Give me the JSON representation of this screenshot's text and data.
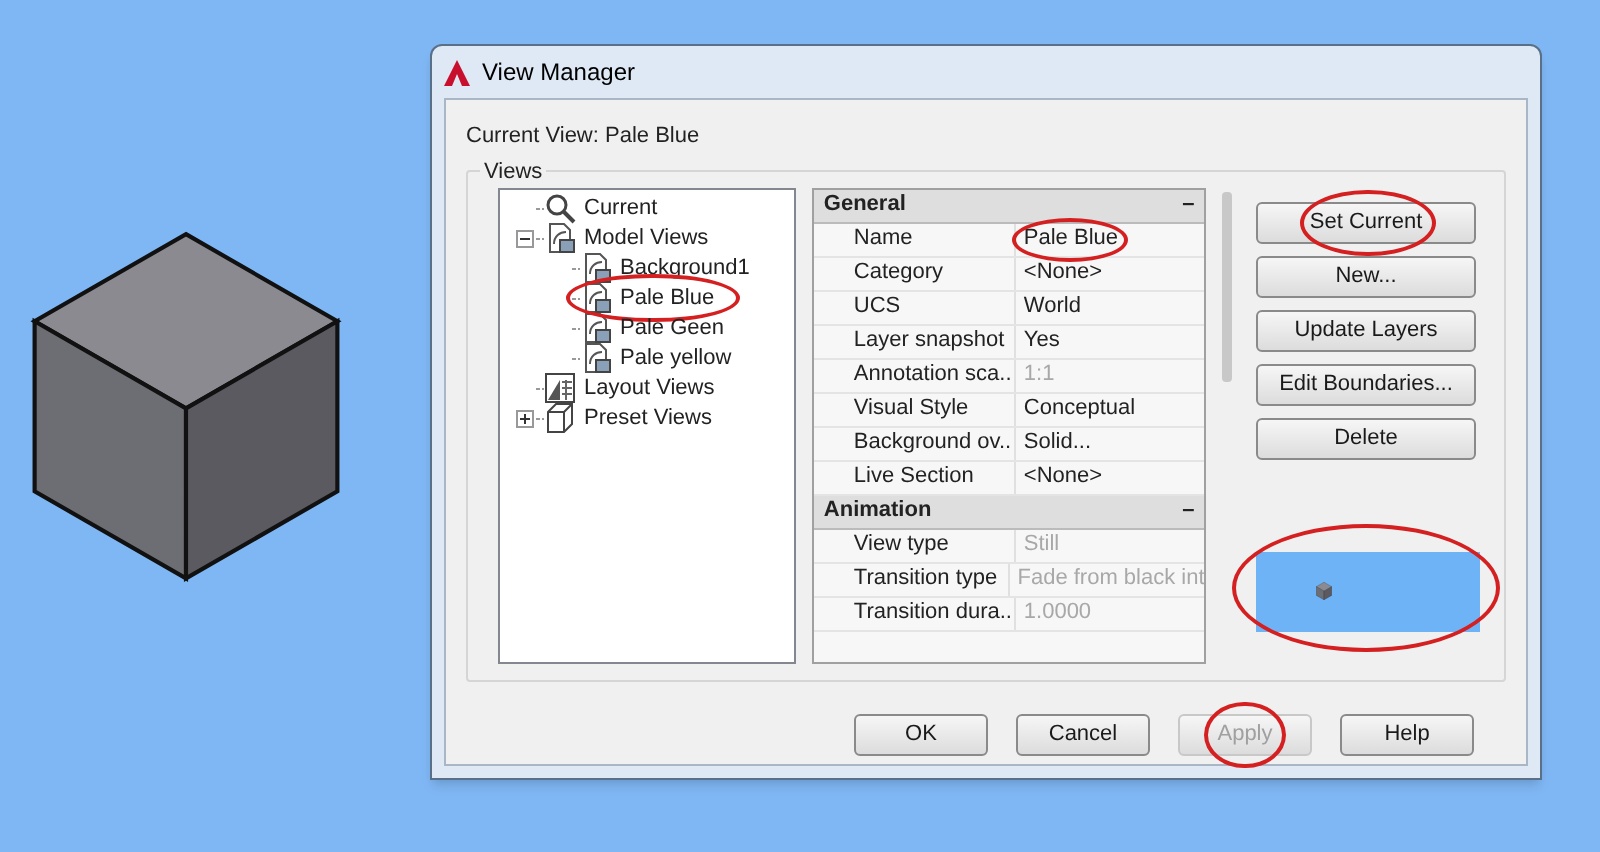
{
  "window": {
    "title": "View Manager"
  },
  "current_view": "Current View: Pale Blue",
  "views_group": {
    "label": "Views"
  },
  "tree": {
    "items": [
      {
        "label": "Current",
        "kind": "current",
        "selected": false,
        "circled": false
      },
      {
        "label": "Model Views",
        "kind": "model",
        "expanded": true,
        "selected": false,
        "circled": false,
        "children": [
          {
            "label": "Background1",
            "kind": "view",
            "selected": false,
            "circled": false
          },
          {
            "label": "Pale Blue",
            "kind": "view",
            "selected": false,
            "circled": true
          },
          {
            "label": "Pale Geen",
            "kind": "view",
            "selected": false,
            "circled": false
          },
          {
            "label": "Pale yellow",
            "kind": "view",
            "selected": false,
            "circled": false
          }
        ]
      },
      {
        "label": "Layout Views",
        "kind": "layout",
        "selected": false,
        "circled": false
      },
      {
        "label": "Preset Views",
        "kind": "preset",
        "expanded": false,
        "selected": false,
        "circled": false
      }
    ]
  },
  "properties": {
    "sections": [
      {
        "title": "General",
        "toggle": "–",
        "rows": [
          {
            "label": "Name",
            "value": "Pale Blue",
            "disabled": false,
            "circled": true
          },
          {
            "label": "Category",
            "value": "<None>",
            "disabled": false,
            "circled": false
          },
          {
            "label": "UCS",
            "value": "World",
            "disabled": false,
            "circled": false
          },
          {
            "label": "Layer snapshot",
            "value": "Yes",
            "disabled": false,
            "circled": false
          },
          {
            "label": "Annotation sca..",
            "value": "1:1",
            "disabled": true,
            "circled": false
          },
          {
            "label": "Visual Style",
            "value": "Conceptual",
            "disabled": false,
            "circled": false
          },
          {
            "label": "Background ov..",
            "value": "Solid...",
            "disabled": false,
            "circled": false
          },
          {
            "label": "Live Section",
            "value": "<None>",
            "disabled": false,
            "circled": false
          }
        ]
      },
      {
        "title": "Animation",
        "toggle": "–",
        "rows": [
          {
            "label": "View type",
            "value": "Still",
            "disabled": true,
            "circled": false
          },
          {
            "label": "Transition type",
            "value": "Fade from black int",
            "disabled": true,
            "circled": false
          },
          {
            "label": "Transition dura..",
            "value": "1.0000",
            "disabled": true,
            "circled": false
          }
        ]
      }
    ]
  },
  "side_buttons": [
    {
      "label": "Set Current",
      "disabled": false,
      "circled": true
    },
    {
      "label": "New...",
      "disabled": false,
      "circled": false
    },
    {
      "label": "Update Layers",
      "disabled": false,
      "circled": false
    },
    {
      "label": "Edit Boundaries...",
      "disabled": false,
      "circled": false
    },
    {
      "label": "Delete",
      "disabled": false,
      "circled": false
    }
  ],
  "preview": {
    "color": "#6fb3f7",
    "circled": true
  },
  "bottom_buttons": [
    {
      "label": "OK",
      "disabled": false,
      "circled": false
    },
    {
      "label": "Cancel",
      "disabled": false,
      "circled": false
    },
    {
      "label": "Apply",
      "disabled": true,
      "circled": true
    },
    {
      "label": "Help",
      "disabled": false,
      "circled": false
    }
  ]
}
